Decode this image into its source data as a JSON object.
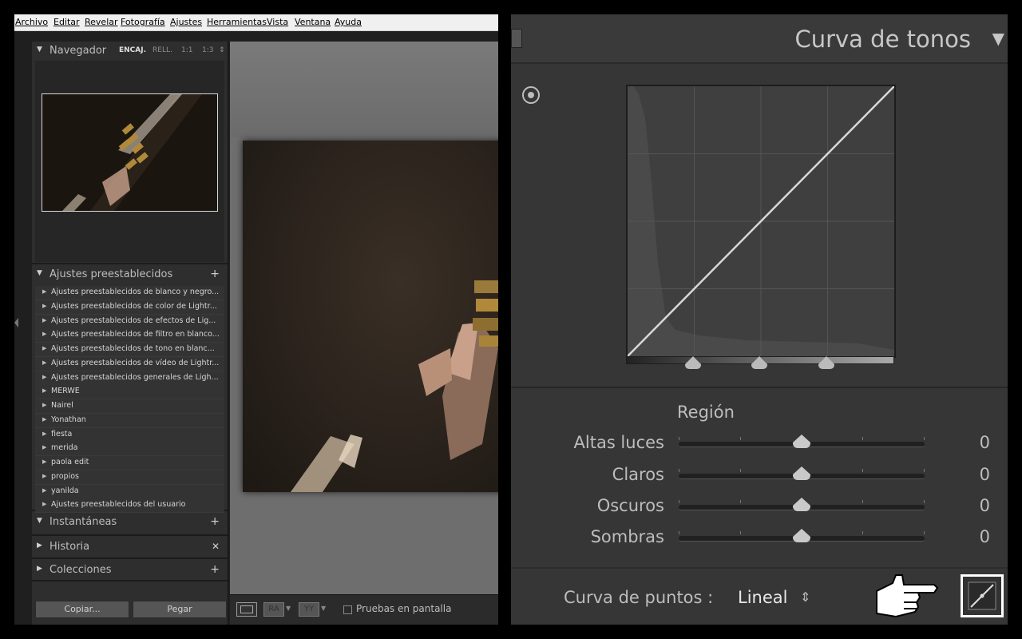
{
  "menu": [
    "Archivo",
    "Editar",
    "Revelar",
    "Fotografía",
    "Ajustes",
    "Herramientas",
    "Vista",
    "Ventana",
    "Ayuda"
  ],
  "navigator": {
    "title": "Navegador",
    "options": [
      "ENCAJ.",
      "RELL.",
      "1:1",
      "1:3"
    ]
  },
  "presets": {
    "title": "Ajustes preestablecidos",
    "items": [
      "Ajustes preestablecidos de blanco y negro...",
      "Ajustes preestablecidos de color de Lightr...",
      "Ajustes preestablecidos de efectos de Lig...",
      "Ajustes preestablecidos de filtro en blanco...",
      "Ajustes preestablecidos de tono en blanc...",
      "Ajustes preestablecidos de vídeo de Lightr...",
      "Ajustes preestablecidos generales de Ligh...",
      "MERWE",
      "Nairel",
      "Yonathan",
      "fiesta",
      "merida",
      "paola edit",
      "propios",
      "yanilda",
      "Ajustes preestablecidos del usuario"
    ]
  },
  "snapshots": {
    "title": "Instantáneas"
  },
  "history": {
    "title": "Historia"
  },
  "collections": {
    "title": "Colecciones"
  },
  "buttons": {
    "copy": "Copiar...",
    "paste": "Pegar"
  },
  "toolbar": {
    "compare1": "RA",
    "compare2": "YY",
    "softproof": "Pruebas en pantalla"
  },
  "tone_curve": {
    "title": "Curva de tonos",
    "region_title": "Región",
    "sliders": [
      {
        "label": "Altas luces",
        "value": "0",
        "position": 0.5
      },
      {
        "label": "Claros",
        "value": "0",
        "position": 0.5
      },
      {
        "label": "Oscuros",
        "value": "0",
        "position": 0.5
      },
      {
        "label": "Sombras",
        "value": "0",
        "position": 0.5
      }
    ],
    "split_points": [
      0.25,
      0.5,
      0.75
    ],
    "point_curve_label": "Curva de puntos :",
    "point_curve_value": "Lineal"
  }
}
